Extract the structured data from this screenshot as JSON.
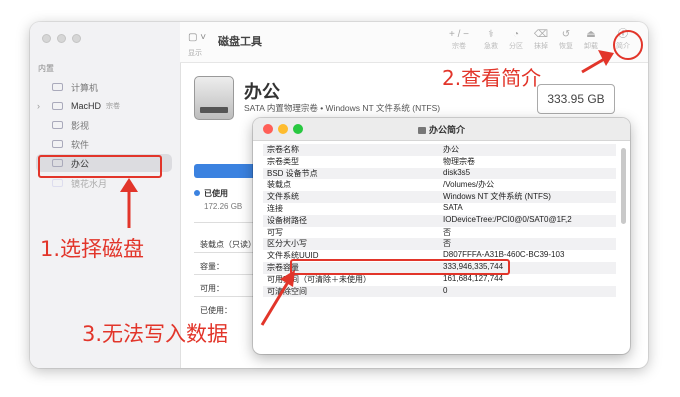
{
  "toolbar": {
    "title": "磁盘工具",
    "show_label": "显示",
    "buttons": [
      {
        "name": "volume-add",
        "glyph": "+ / −",
        "label": "宗卷"
      },
      {
        "name": "first-aid",
        "glyph": "⚕",
        "label": "急救"
      },
      {
        "name": "partition",
        "glyph": "◔",
        "label": "分区"
      },
      {
        "name": "erase",
        "glyph": "⌫",
        "label": "抹掉"
      },
      {
        "name": "restore",
        "glyph": "↺",
        "label": "恢复"
      },
      {
        "name": "unmount",
        "glyph": "⏏",
        "label": "卸载"
      },
      {
        "name": "info",
        "glyph": "ⓘ",
        "label": "简介"
      }
    ]
  },
  "sidebar": {
    "section": "内置",
    "items": [
      {
        "label": "计算机",
        "sub": ""
      },
      {
        "label": "MacHD",
        "sub": "宗卷"
      },
      {
        "label": "影视",
        "sub": ""
      },
      {
        "label": "软件",
        "sub": ""
      },
      {
        "label": "办公",
        "sub": ""
      },
      {
        "label": "镜花水月",
        "sub": ""
      }
    ],
    "selected_index": 4
  },
  "volume": {
    "name": "办公",
    "description": "SATA 内置物理宗卷 • Windows NT 文件系统 (NTFS)",
    "size": "333.95 GB",
    "used_label": "已使用",
    "used_value": "172.26 GB",
    "info_labels": [
      "装载点（只读）：",
      "容量：",
      "可用：",
      "已使用："
    ]
  },
  "info_panel": {
    "title": "办公简介",
    "rows": [
      {
        "key": "宗卷名称",
        "value": "办公"
      },
      {
        "key": "宗卷类型",
        "value": "物理宗卷"
      },
      {
        "key": "BSD 设备节点",
        "value": "disk3s5"
      },
      {
        "key": "装载点",
        "value": "/Volumes/办公"
      },
      {
        "key": "文件系统",
        "value": "Windows NT 文件系统 (NTFS)"
      },
      {
        "key": "连接",
        "value": "SATA"
      },
      {
        "key": "设备树路径",
        "value": "IODeviceTree:/PCI0@0/SAT0@1F,2"
      },
      {
        "key": "可写",
        "value": "否"
      },
      {
        "key": "区分大小写",
        "value": "否"
      },
      {
        "key": "文件系统UUID",
        "value": "D807FFFA-A31B-460C-BC39-103"
      },
      {
        "key": "宗卷容量",
        "value": "333,946,335,744"
      },
      {
        "key": "可用空间（可清除＋未使用）",
        "value": "161,684,127,744"
      },
      {
        "key": "可清除空间",
        "value": "0"
      }
    ]
  },
  "annotations": {
    "step1": "1.选择磁盘",
    "step2": "2.查看简介",
    "step3": "3.无法写入数据",
    "color": "#e2352a"
  }
}
